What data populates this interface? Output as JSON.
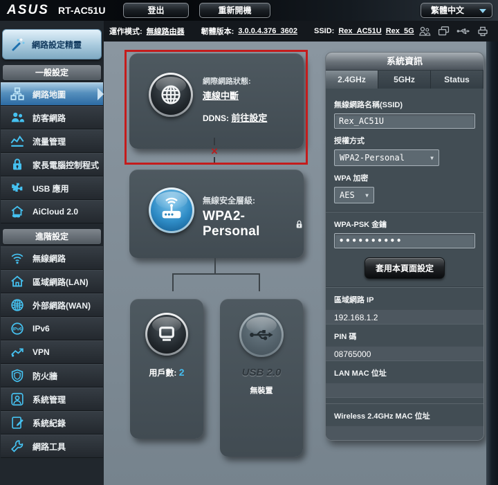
{
  "topbar": {
    "brand": "ASUS",
    "model": "RT-AC51U",
    "logout_label": "登出",
    "reboot_label": "重新開機",
    "language_label": "繁體中文"
  },
  "infobar": {
    "op_mode_label": "運作模式:",
    "op_mode_value": "無線路由器",
    "fw_label": "韌體版本:",
    "fw_value": "3.0.0.4.376_3602",
    "ssid_label": "SSID:",
    "ssid_2g": "Rex_AC51U",
    "ssid_5g": "Rex_5G"
  },
  "sidebar": {
    "qis_label": "網路設定精靈",
    "general_header": "一般設定",
    "general_items": [
      {
        "label": "網路地圖",
        "icon": "network-map"
      },
      {
        "label": "訪客網路",
        "icon": "guest-network"
      },
      {
        "label": "流量管理",
        "icon": "traffic-manager"
      },
      {
        "label": "家長電腦控制程式",
        "icon": "parental-controls"
      },
      {
        "label": "USB 應用",
        "icon": "usb-application"
      },
      {
        "label": "AiCloud 2.0",
        "icon": "aicloud"
      }
    ],
    "advanced_header": "進階設定",
    "advanced_items": [
      {
        "label": "無線網路",
        "icon": "wireless"
      },
      {
        "label": "區域網路(LAN)",
        "icon": "lan"
      },
      {
        "label": "外部網路(WAN)",
        "icon": "wan"
      },
      {
        "label": "IPv6",
        "icon": "ipv6"
      },
      {
        "label": "VPN",
        "icon": "vpn"
      },
      {
        "label": "防火牆",
        "icon": "firewall"
      },
      {
        "label": "系統管理",
        "icon": "administration"
      },
      {
        "label": "系統紀錄",
        "icon": "system-log"
      },
      {
        "label": "網路工具",
        "icon": "network-tools"
      }
    ]
  },
  "network_map": {
    "internet": {
      "status_label": "網際網路狀態:",
      "status_link": "連線中斷",
      "ddns_label": "DDNS:",
      "ddns_link": "前往設定"
    },
    "security": {
      "label": "無線安全層級:",
      "value": "WPA2-Personal"
    },
    "clients": {
      "label": "用戶數:",
      "count": "2"
    },
    "usb": {
      "title": "USB 2.0",
      "status": "無裝置"
    }
  },
  "system_info": {
    "title": "系統資訊",
    "tabs": [
      {
        "label": "2.4GHz"
      },
      {
        "label": "5GHz"
      },
      {
        "label": "Status"
      }
    ],
    "ssid_label": "無線網路名稱(SSID)",
    "ssid_value": "Rex_AC51U",
    "auth_label": "授權方式",
    "auth_value": "WPA2-Personal",
    "wpa_enc_label": "WPA 加密",
    "wpa_enc_value": "AES",
    "psk_label": "WPA-PSK 金鑰",
    "psk_value": "••••••••••",
    "apply_label": "套用本頁面設定",
    "lan_ip_label": "區域網路 IP",
    "lan_ip_value": "192.168.1.2",
    "pin_label": "PIN 碼",
    "pin_value": "08765000",
    "lan_mac_label": "LAN MAC 位址",
    "lan_mac_value": "",
    "wl_mac_label": "Wireless 2.4GHz MAC 位址",
    "wl_mac_value": ""
  },
  "colors": {
    "accent": "#45bdf0",
    "alert": "#c41c1c",
    "active_nav": "#2c6ba3"
  }
}
